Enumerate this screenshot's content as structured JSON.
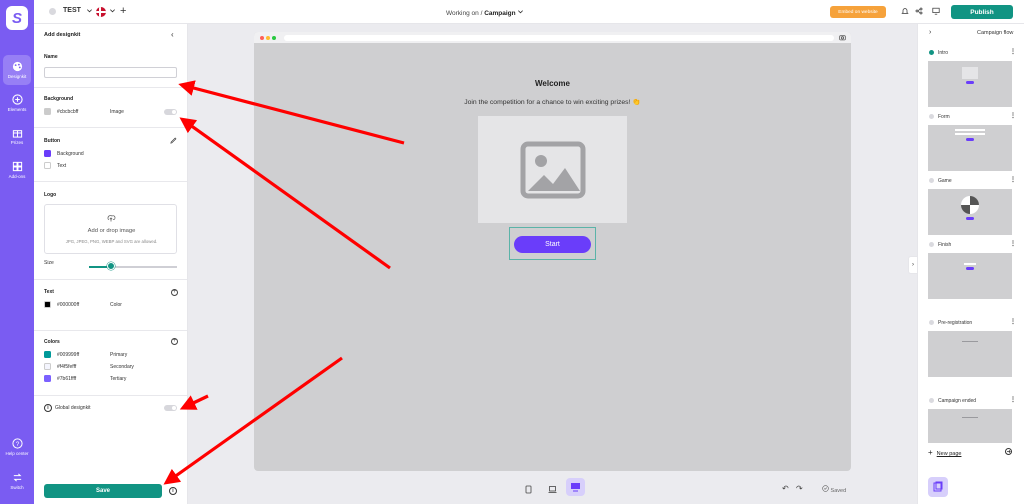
{
  "rail": {
    "items": [
      {
        "label": "Designkit",
        "icon": "palette-icon"
      },
      {
        "label": "Elements",
        "icon": "plus-circle-icon"
      },
      {
        "label": "Prizes",
        "icon": "gift-icon"
      },
      {
        "label": "Add-ons",
        "icon": "puzzle-icon"
      },
      {
        "label": "Help center",
        "icon": "help-icon"
      },
      {
        "label": "Switch",
        "icon": "switch-icon"
      }
    ]
  },
  "topbar": {
    "project_name": "TEST",
    "working_on_prefix": "Working on /",
    "working_on_value": "Campaign",
    "embed_label": "Embed on website",
    "publish_label": "Publish"
  },
  "panel": {
    "title": "Add designkit",
    "name_label": "Name",
    "name_value": "",
    "background_label": "Background",
    "background_color_hex": "#cbcbcbff",
    "background_color": "#cbcbcb",
    "image_label": "Image",
    "button_label": "Button",
    "button_bg_label": "Background",
    "button_bg_color": "#6a3dfa",
    "button_text_label": "Text",
    "logo_label": "Logo",
    "drop_title": "Add or drop image",
    "drop_formats": "JPG, JPEG, PNG, WEBP and SVG are allowed.",
    "size_label": "Size",
    "size_value": 0.25,
    "text_label": "Text",
    "text_color_hex": "#000000ff",
    "text_color_role": "Color",
    "colors_label": "Colors",
    "colors": [
      {
        "hex": "#009999ff",
        "role": "Primary",
        "swatch": "#009999"
      },
      {
        "hex": "#f4f5fefff",
        "role": "Secondary",
        "swatch": "#f4f5fe"
      },
      {
        "hex": "#7b61ffff",
        "role": "Tertiary",
        "swatch": "#7b61ff"
      }
    ],
    "global_label": "Global designkit",
    "save_label": "Save"
  },
  "canvas": {
    "welcome_title": "Welcome",
    "welcome_sub": "Join the competition for a chance to win exciting prizes! 👏",
    "start_label": "Start",
    "saved_label": "Saved"
  },
  "flow": {
    "title": "Campaign flow",
    "pages": [
      {
        "name": "Intro",
        "active": true
      },
      {
        "name": "Form",
        "active": false
      },
      {
        "name": "Game",
        "active": false
      },
      {
        "name": "Finish",
        "active": false
      },
      {
        "name": "Pre-registration",
        "active": false
      },
      {
        "name": "Campaign ended",
        "active": false
      }
    ],
    "new_page_label": "New page"
  },
  "colors": {
    "rail": "#7a5cf2",
    "primary": "#119483",
    "accent": "#6a3dfa",
    "annotation": "#ff0000"
  }
}
